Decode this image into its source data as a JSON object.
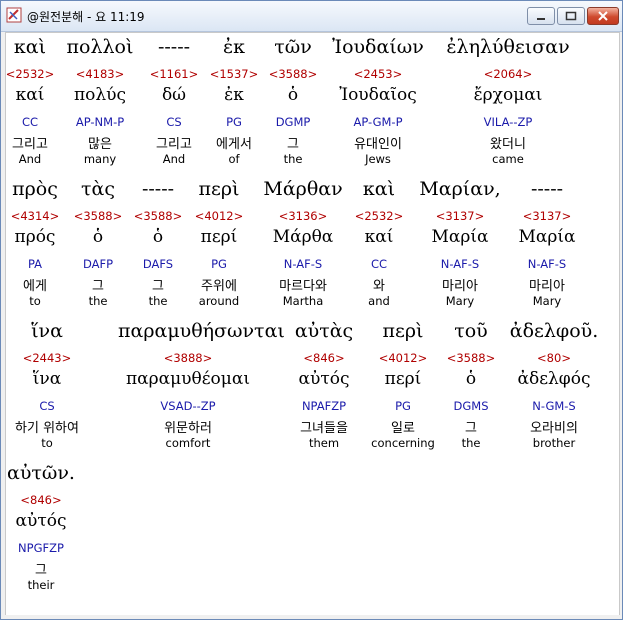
{
  "window": {
    "title": "@원전분해 - 요 11:19"
  },
  "verse": [
    {
      "greek": "καὶ",
      "strong": "<2532>",
      "lemma": "καί",
      "morph": "CC",
      "korean": "그리고",
      "english": "And"
    },
    {
      "greek": "πολλοὶ",
      "strong": "<4183>",
      "lemma": "πολύς",
      "morph": "AP-NM-P",
      "korean": "많은",
      "english": "many"
    },
    {
      "greek": "-----",
      "strong": "<1161>",
      "lemma": "δώ",
      "morph": "CS",
      "korean": "그리고",
      "english": "And"
    },
    {
      "greek": "ἐκ",
      "strong": "<1537>",
      "lemma": "ἐκ",
      "morph": "PG",
      "korean": "에게서",
      "english": "of"
    },
    {
      "greek": "τῶν",
      "strong": "<3588>",
      "lemma": "ὁ",
      "morph": "DGMP",
      "korean": "그",
      "english": "the"
    },
    {
      "greek": "Ἰουδαίων",
      "strong": "<2453>",
      "lemma": "Ἰουδαῖος",
      "morph": "AP-GM-P",
      "korean": "유대인이",
      "english": "Jews"
    },
    {
      "greek": "ἐληλύθεισαν",
      "strong": "<2064>",
      "lemma": "ἔρχομαι",
      "morph": "VILA--ZP",
      "korean": "왔더니",
      "english": "came"
    },
    {
      "greek": "πρὸς",
      "strong": "<4314>",
      "lemma": "πρός",
      "morph": "PA",
      "korean": "에게",
      "english": "to"
    },
    {
      "greek": "τὰς",
      "strong": "<3588>",
      "lemma": "ὁ",
      "morph": "DAFP",
      "korean": "그",
      "english": "the"
    },
    {
      "greek": "-----",
      "strong": "<3588>",
      "lemma": "ὁ",
      "morph": "DAFS",
      "korean": "그",
      "english": "the"
    },
    {
      "greek": "περὶ",
      "strong": "<4012>",
      "lemma": "περί",
      "morph": "PG",
      "korean": "주위에",
      "english": "around"
    },
    {
      "greek": "Μάρθαν",
      "strong": "<3136>",
      "lemma": "Μάρθα",
      "morph": "N-AF-S",
      "korean": "마르다와",
      "english": "Martha"
    },
    {
      "greek": "καὶ",
      "strong": "<2532>",
      "lemma": "καί",
      "morph": "CC",
      "korean": "와",
      "english": "and"
    },
    {
      "greek": "Μαρίαν,",
      "strong": "<3137>",
      "lemma": "Μαρία",
      "morph": "N-AF-S",
      "korean": "마리아",
      "english": "Mary"
    },
    {
      "greek": "-----",
      "strong": "<3137>",
      "lemma": "Μαρία",
      "morph": "N-AF-S",
      "korean": "마리아",
      "english": "Mary"
    },
    {
      "greek": "ἵνα",
      "strong": "<2443>",
      "lemma": "ἵνα",
      "morph": "CS",
      "korean": "하기 위하여",
      "english": "to"
    },
    {
      "greek": "παραμυθήσωνται",
      "strong": "<3888>",
      "lemma": "παραμυθέομαι",
      "morph": "VSAD--ZP",
      "korean": "위문하러",
      "english": "comfort"
    },
    {
      "greek": "αὐτὰς",
      "strong": "<846>",
      "lemma": "αὐτός",
      "morph": "NPAFZP",
      "korean": "그녀들을",
      "english": "them"
    },
    {
      "greek": "περὶ",
      "strong": "<4012>",
      "lemma": "περί",
      "morph": "PG",
      "korean": "일로",
      "english": "concerning"
    },
    {
      "greek": "τοῦ",
      "strong": "<3588>",
      "lemma": "ὁ",
      "morph": "DGMS",
      "korean": "그",
      "english": "the"
    },
    {
      "greek": "ἀδελφοῦ.",
      "strong": "<80>",
      "lemma": "ἀδελφός",
      "morph": "N-GM-S",
      "korean": "오라비의",
      "english": "brother"
    },
    {
      "greek": "αὐτῶν.",
      "strong": "<846>",
      "lemma": "αὐτός",
      "morph": "NPGFZP",
      "korean": "그",
      "english": "their"
    }
  ]
}
